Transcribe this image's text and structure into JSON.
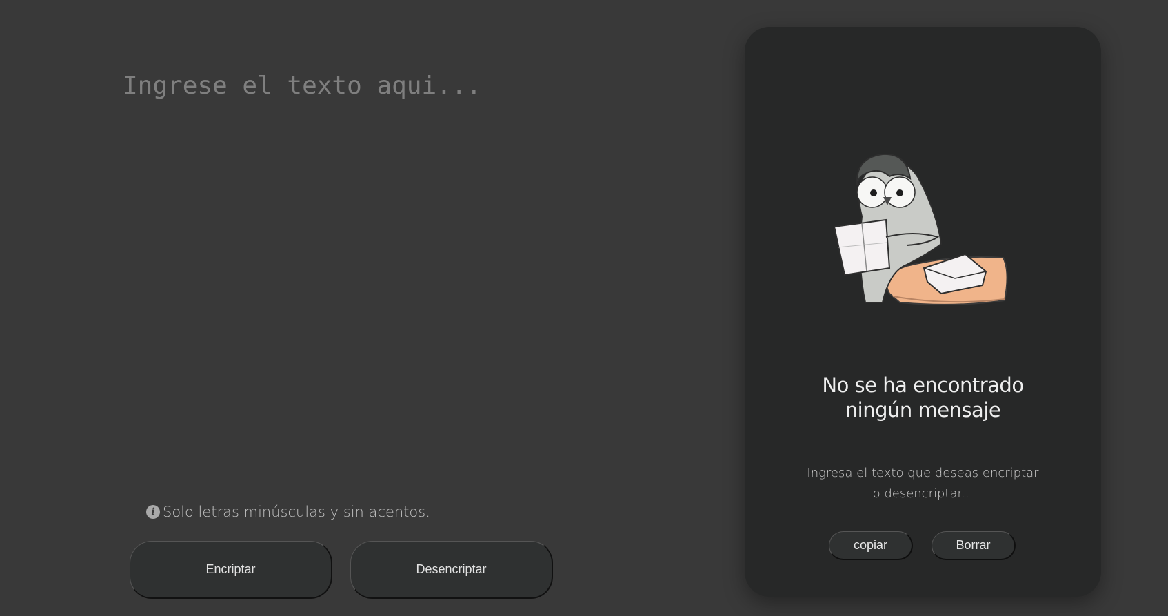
{
  "input": {
    "placeholder": "Ingrese el texto aqui...",
    "value": ""
  },
  "hint": {
    "icon": "info-icon",
    "text": "Solo letras minúsculas y sin acentos."
  },
  "actions": {
    "encrypt_label": "Encriptar",
    "decrypt_label": "Desencriptar"
  },
  "output_card": {
    "illustration": "penguin-reading-letter",
    "title": "No se ha encontrado ningún mensaje",
    "subtitle": "Ingresa el texto que deseas encriptar o desencriptar...",
    "copy_label": "copiar",
    "clear_label": "Borrar"
  },
  "colors": {
    "background": "#393939",
    "card": "#272828",
    "button": "#2f3131",
    "placeholder": "#7f7f7f",
    "accent_orange": "#f0b48a"
  }
}
